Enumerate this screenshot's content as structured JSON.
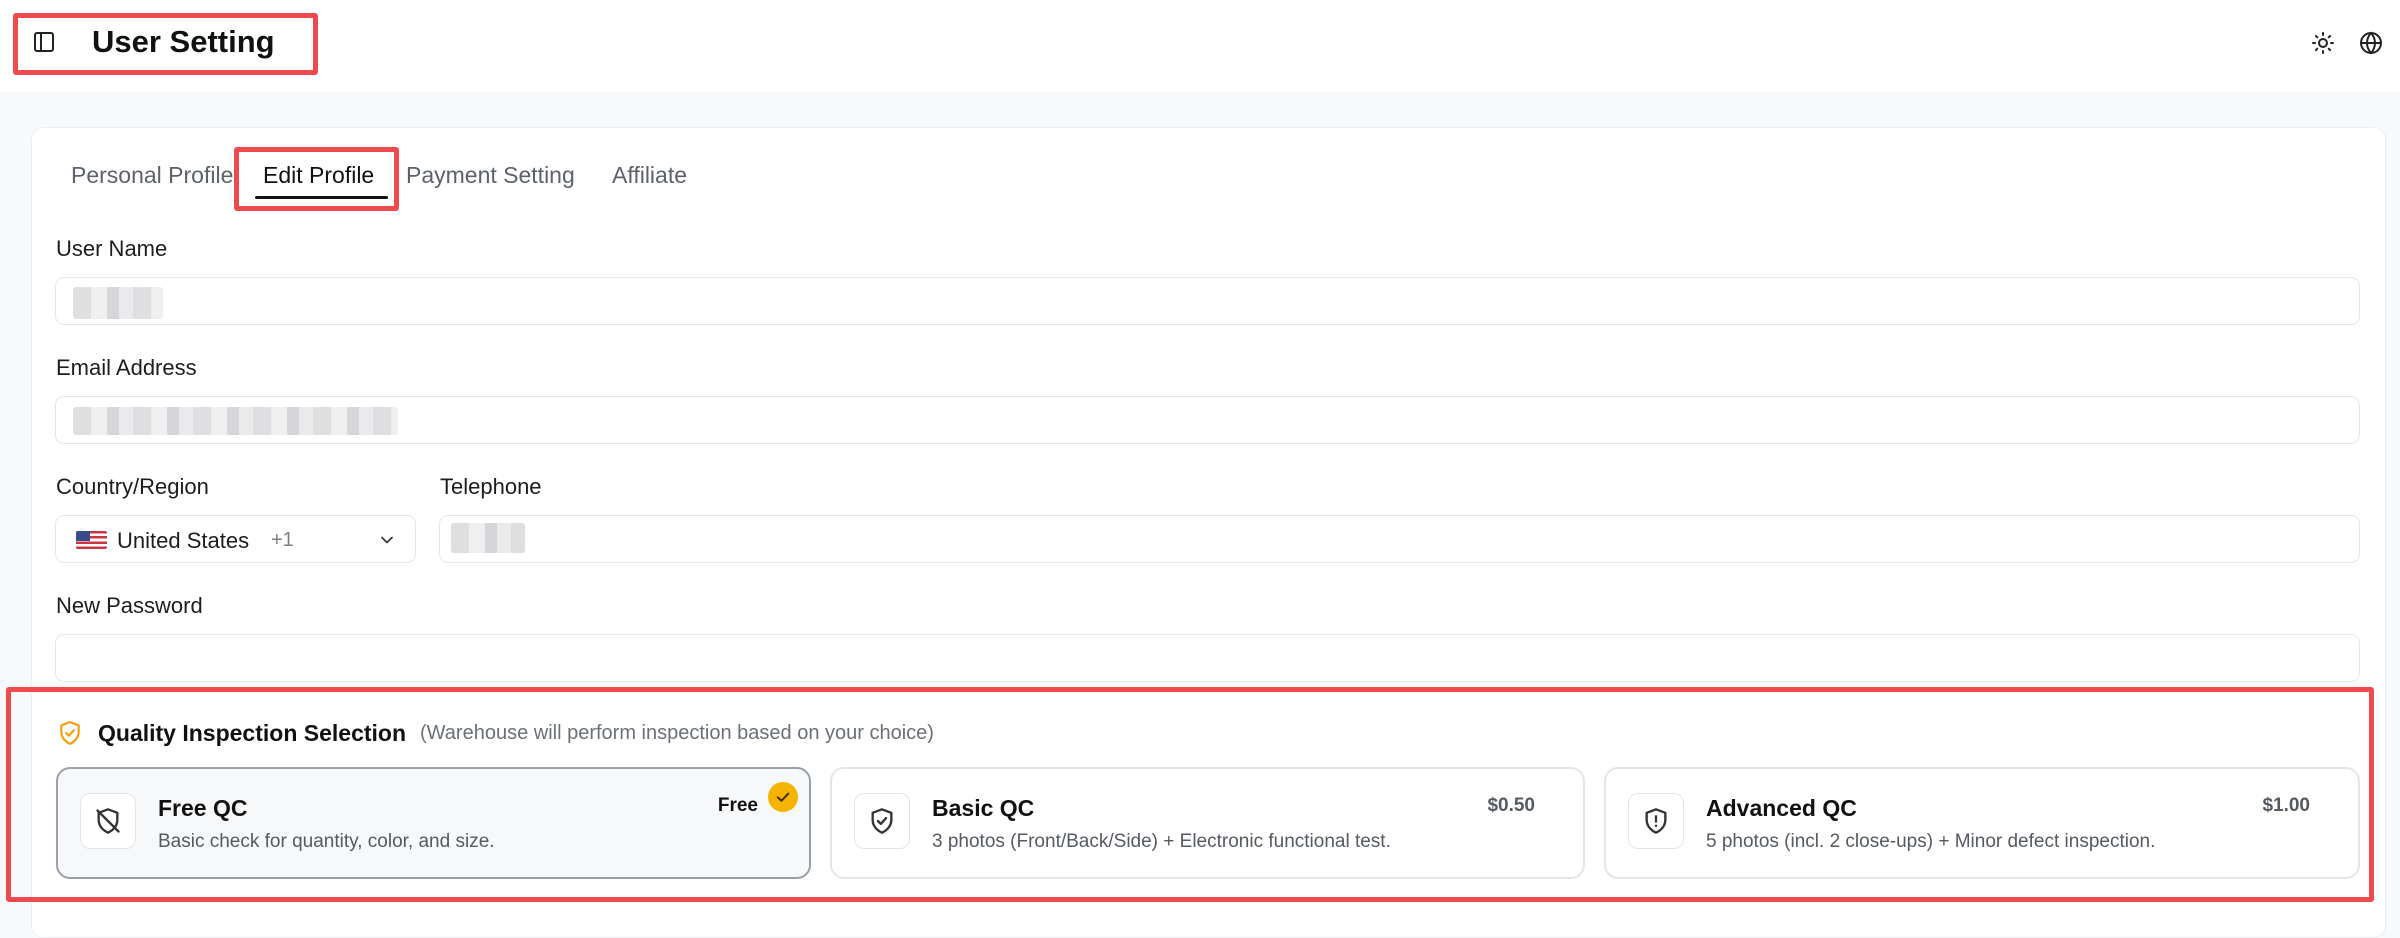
{
  "header": {
    "title": "User Setting",
    "icons": [
      "sidebar-toggle-icon",
      "sun-icon",
      "globe-icon"
    ]
  },
  "tabs": [
    {
      "label": "Personal Profile"
    },
    {
      "label": "Edit Profile",
      "active": true
    },
    {
      "label": "Payment Setting"
    },
    {
      "label": "Affiliate"
    }
  ],
  "form": {
    "username": {
      "label": "User Name",
      "value": ""
    },
    "email": {
      "label": "Email Address",
      "value": ""
    },
    "country": {
      "label": "Country/Region",
      "value": "United States",
      "code": "+1"
    },
    "telephone": {
      "label": "Telephone",
      "value": ""
    },
    "password": {
      "label": "New Password",
      "value": ""
    }
  },
  "qc": {
    "title": "Quality Inspection Selection",
    "subtitle": "(Warehouse will perform inspection based on your choice)",
    "options": [
      {
        "name": "Free QC",
        "desc": "Basic check for quantity, color, and size.",
        "price": "Free",
        "selected": true,
        "icon": "shield-off-icon"
      },
      {
        "name": "Basic QC",
        "desc": "3 photos (Front/Back/Side) + Electronic functional test.",
        "price": "$0.50",
        "selected": false,
        "icon": "shield-check-icon"
      },
      {
        "name": "Advanced QC",
        "desc": "5 photos (incl. 2 close-ups) + Minor defect inspection.",
        "price": "$1.00",
        "selected": false,
        "icon": "shield-alert-icon"
      }
    ]
  },
  "colors": {
    "highlight": "#ef4b4f",
    "accent_check": "#f5b400",
    "qc_shield": "#f59e0b"
  }
}
